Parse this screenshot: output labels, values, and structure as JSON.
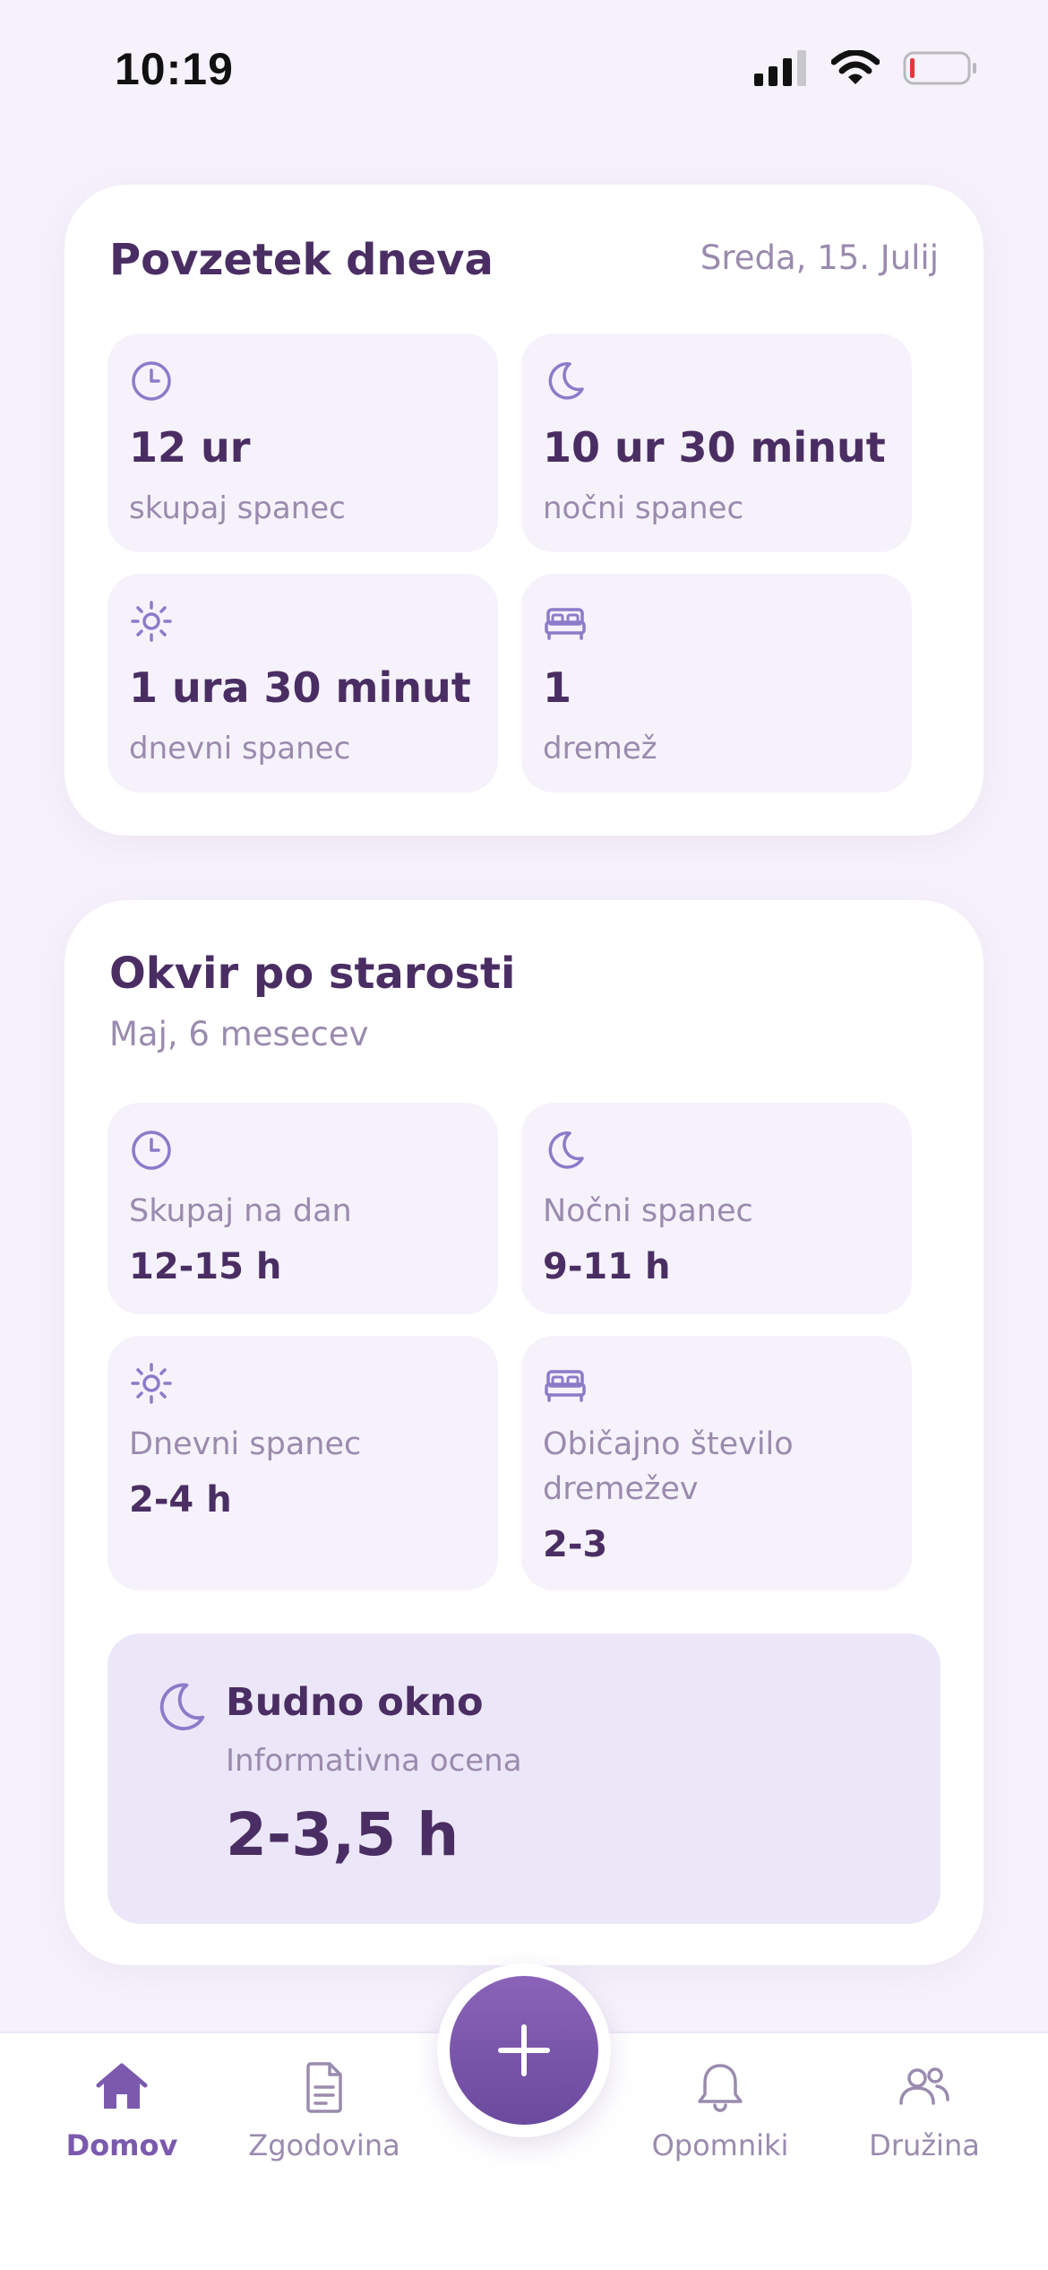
{
  "status_bar": {
    "time": "10:19"
  },
  "summary": {
    "title": "Povzetek dneva",
    "date": "Sreda, 15. Julij",
    "tiles": [
      {
        "icon": "clock-icon",
        "value": "12 ur",
        "caption": "skupaj spanec"
      },
      {
        "icon": "moon-icon",
        "value": "10 ur 30 minut",
        "caption": "nočni spanec"
      },
      {
        "icon": "sun-icon",
        "value": "1 ura 30 minut",
        "caption": "dnevni spanec"
      },
      {
        "icon": "bed-icon",
        "value": "1",
        "caption": "dremež"
      }
    ]
  },
  "age_frame": {
    "title": "Okvir po starosti",
    "subtitle": "Maj, 6 mesecev",
    "tiles": [
      {
        "icon": "clock-icon",
        "label": "Skupaj na dan",
        "value": "12-15 h"
      },
      {
        "icon": "moon-icon",
        "label": "Nočni spanec",
        "value": "9-11 h"
      },
      {
        "icon": "sun-icon",
        "label": "Dnevni spanec",
        "value": "2-4 h"
      },
      {
        "icon": "bed-icon",
        "label": "Običajno število dremežev",
        "value": "2-3"
      }
    ],
    "wake_window": {
      "icon": "moon-icon",
      "title": "Budno okno",
      "subtitle": "Informativna ocena",
      "value": "2-3,5 h"
    }
  },
  "nav": {
    "items": [
      {
        "icon": "home-icon",
        "label": "Domov",
        "active": true
      },
      {
        "icon": "document-icon",
        "label": "Zgodovina",
        "active": false
      },
      {
        "icon": "bell-icon",
        "label": "Opomniki",
        "active": false
      },
      {
        "icon": "family-icon",
        "label": "Družina",
        "active": false
      }
    ],
    "add_icon": "plus-icon"
  },
  "colors": {
    "background": "#F6F2FB",
    "card": "#FFFFFF",
    "tile": "#F6F2FB",
    "highlight": "#ECE7F8",
    "heading": "#4A2E63",
    "muted": "#9A8BAE",
    "accent": "#7B5AAE",
    "icon": "#8C7BC9"
  }
}
